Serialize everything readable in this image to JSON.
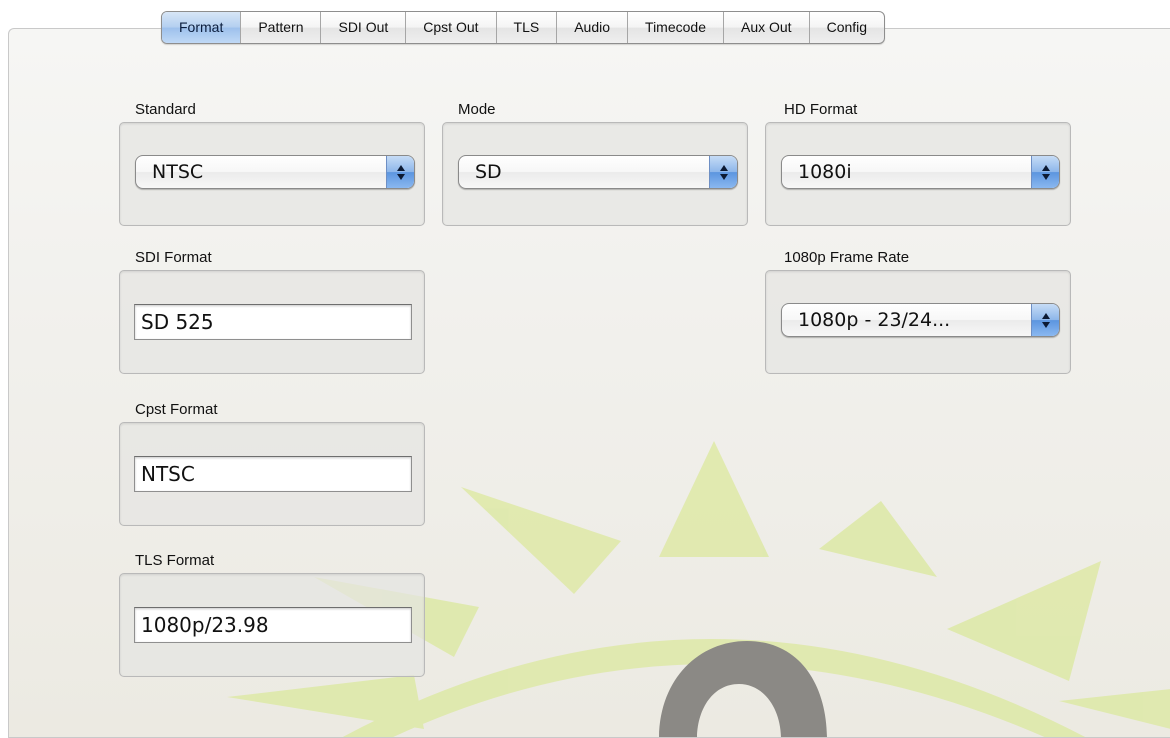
{
  "tabs": [
    {
      "label": "Format",
      "active": true
    },
    {
      "label": "Pattern",
      "active": false
    },
    {
      "label": "SDI Out",
      "active": false
    },
    {
      "label": "Cpst Out",
      "active": false
    },
    {
      "label": "TLS",
      "active": false
    },
    {
      "label": "Audio",
      "active": false
    },
    {
      "label": "Timecode",
      "active": false
    },
    {
      "label": "Aux Out",
      "active": false
    },
    {
      "label": "Config",
      "active": false
    }
  ],
  "groups": {
    "standard": {
      "label": "Standard",
      "value": "NTSC"
    },
    "mode": {
      "label": "Mode",
      "value": "SD"
    },
    "hd_format": {
      "label": "HD Format",
      "value": "1080i"
    },
    "sdi_format": {
      "label": "SDI Format",
      "value": "SD 525"
    },
    "frame_rate_1080p": {
      "label": "1080p Frame Rate",
      "value": "1080p - 23/24..."
    },
    "cpst_format": {
      "label": "Cpst Format",
      "value": "NTSC"
    },
    "tls_format": {
      "label": "TLS Format",
      "value": "1080p/23.98"
    }
  },
  "colors": {
    "active_tab": "#a9c8ef",
    "popup_arrow_blue": "#5c95df",
    "watermark_green": "#dde8a8",
    "watermark_gray": "#8a8885"
  },
  "icons": {
    "popup_arrows": "up-down-arrows-icon",
    "watermark": "eye-logo"
  }
}
